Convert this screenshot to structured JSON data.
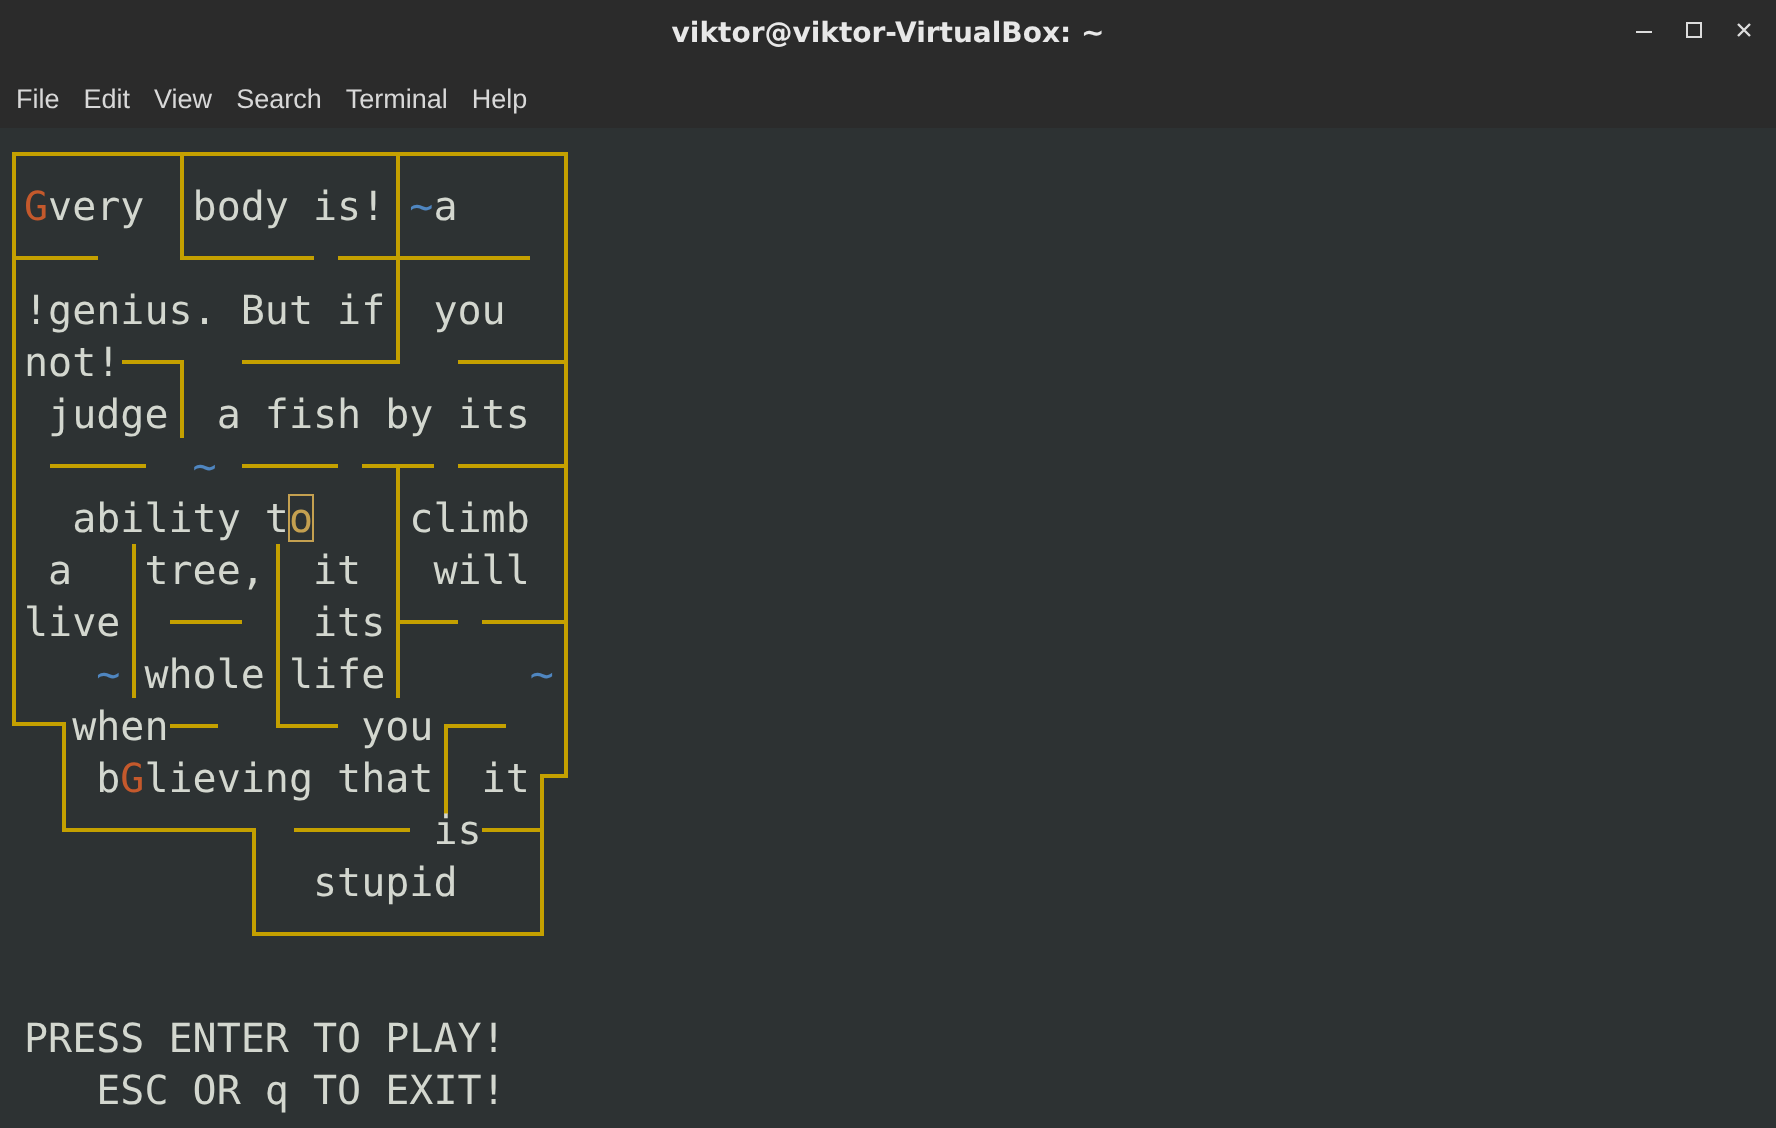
{
  "window": {
    "title": "viktor@viktor-VirtualBox: ~"
  },
  "menu": [
    "File",
    "Edit",
    "View",
    "Search",
    "Terminal",
    "Help"
  ],
  "maze": {
    "lines": [
      [
        {
          "kind": "player",
          "text": "G"
        },
        {
          "kind": "plain",
          "text": "very  body is! "
        },
        {
          "kind": "marker",
          "text": "~"
        },
        {
          "kind": "plain",
          "text": "a"
        }
      ],
      [
        {
          "kind": "plain",
          "text": "!genius. But if  you"
        }
      ],
      [
        {
          "kind": "plain",
          "text": "not!"
        }
      ],
      [
        {
          "kind": "plain",
          "text": " judge  a fish by its"
        }
      ],
      [
        {
          "kind": "marker",
          "text": "       ~"
        }
      ],
      [
        {
          "kind": "plain",
          "text": "  ability t"
        },
        {
          "kind": "cursor",
          "text": "o"
        },
        {
          "kind": "plain",
          "text": "    climb"
        }
      ],
      [
        {
          "kind": "plain",
          "text": " a   tree,  it   will"
        }
      ],
      [
        {
          "kind": "plain",
          "text": "live        its"
        }
      ],
      [
        {
          "kind": "marker",
          "text": "   ~"
        },
        {
          "kind": "plain",
          "text": " whole life      "
        },
        {
          "kind": "marker",
          "text": "~"
        }
      ],
      [
        {
          "kind": "plain",
          "text": "  when        you"
        }
      ],
      [
        {
          "kind": "plain",
          "text": "   b"
        },
        {
          "kind": "player",
          "text": "G"
        },
        {
          "kind": "plain",
          "text": "lieving that  it"
        }
      ],
      [
        {
          "kind": "plain",
          "text": "                 is"
        }
      ],
      [
        {
          "kind": "plain",
          "text": "            stupid"
        }
      ]
    ]
  },
  "prompt": [
    "PRESS ENTER TO PLAY!",
    "   ESC OR q TO EXIT!"
  ]
}
